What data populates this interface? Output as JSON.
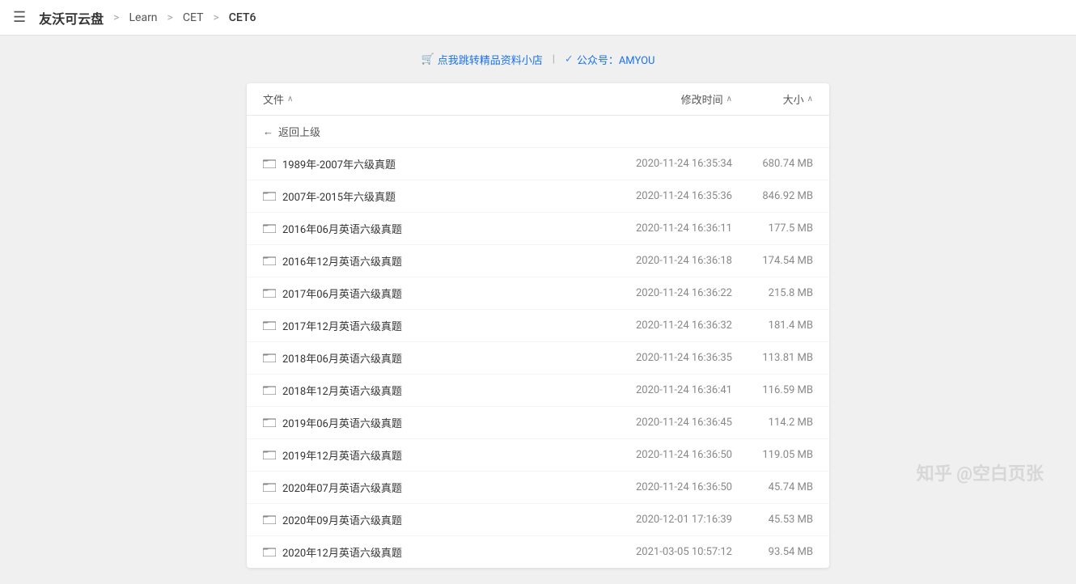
{
  "topbar": {
    "menu_icon": "☰",
    "brand": "友沃可云盘",
    "breadcrumbs": [
      {
        "label": "Learn",
        "active": false
      },
      {
        "label": "CET",
        "active": false
      },
      {
        "label": "CET6",
        "active": true
      }
    ],
    "sep": ">"
  },
  "promo": {
    "cart_icon": "🛒",
    "shop_link": "点我跳转精品资料小店",
    "sep": "|",
    "check_icon": "✓",
    "public_label": "公众号：AMYOU"
  },
  "table": {
    "col_name": "文件",
    "col_date": "修改时间",
    "col_size": "大小",
    "sort_asc": "∧",
    "back_label": "返回上级",
    "back_arrow": "←",
    "files": [
      {
        "name": "1989年-2007年六级真题",
        "date": "2020-11-24 16:35:34",
        "size": "680.74 MB"
      },
      {
        "name": "2007年-2015年六级真题",
        "date": "2020-11-24 16:35:36",
        "size": "846.92 MB"
      },
      {
        "name": "2016年06月英语六级真题",
        "date": "2020-11-24 16:36:11",
        "size": "177.5 MB"
      },
      {
        "name": "2016年12月英语六级真题",
        "date": "2020-11-24 16:36:18",
        "size": "174.54 MB"
      },
      {
        "name": "2017年06月英语六级真题",
        "date": "2020-11-24 16:36:22",
        "size": "215.8 MB"
      },
      {
        "name": "2017年12月英语六级真题",
        "date": "2020-11-24 16:36:32",
        "size": "181.4 MB"
      },
      {
        "name": "2018年06月英语六级真题",
        "date": "2020-11-24 16:36:35",
        "size": "113.81 MB"
      },
      {
        "name": "2018年12月英语六级真题",
        "date": "2020-11-24 16:36:41",
        "size": "116.59 MB"
      },
      {
        "name": "2019年06月英语六级真题",
        "date": "2020-11-24 16:36:45",
        "size": "114.2 MB"
      },
      {
        "name": "2019年12月英语六级真题",
        "date": "2020-11-24 16:36:50",
        "size": "119.05 MB"
      },
      {
        "name": "2020年07月英语六级真题",
        "date": "2020-11-24 16:36:50",
        "size": "45.74 MB"
      },
      {
        "name": "2020年09月英语六级真题",
        "date": "2020-12-01 17:16:39",
        "size": "45.53 MB"
      },
      {
        "name": "2020年12月英语六级真题",
        "date": "2021-03-05 10:57:12",
        "size": "93.54 MB"
      }
    ]
  },
  "watermark": "知乎 @空白页张"
}
